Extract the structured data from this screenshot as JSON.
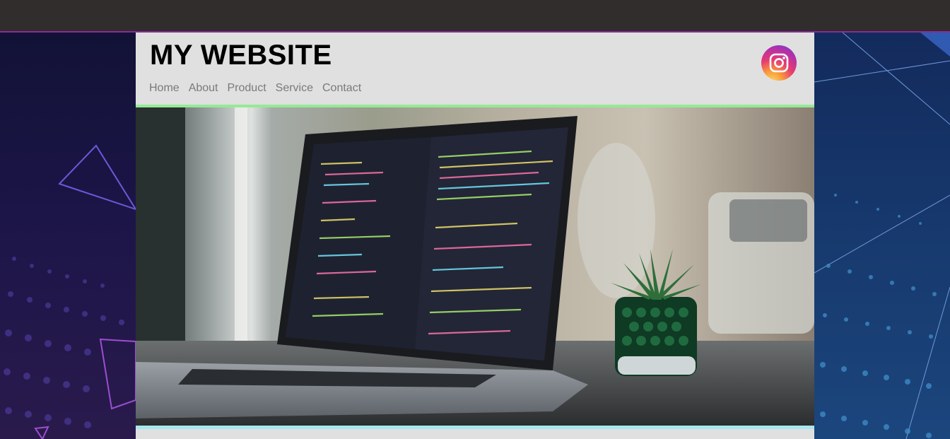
{
  "site": {
    "title": "MY WEBSITE",
    "nav": [
      {
        "label": "Home"
      },
      {
        "label": "About"
      },
      {
        "label": "Product"
      },
      {
        "label": "Service"
      },
      {
        "label": "Contact"
      }
    ],
    "social_icon": "instagram-icon",
    "hero_image": "laptop-with-code-and-plant-photo"
  },
  "colors": {
    "header_bg": "#e0e0e0",
    "title": "#000000",
    "nav_text": "#7a7a7a",
    "green_divider": "#94ea95",
    "cyan_divider": "#a9e7ee",
    "top_bar": "#302d2c",
    "top_bar_accent": "#8a2a9a"
  }
}
